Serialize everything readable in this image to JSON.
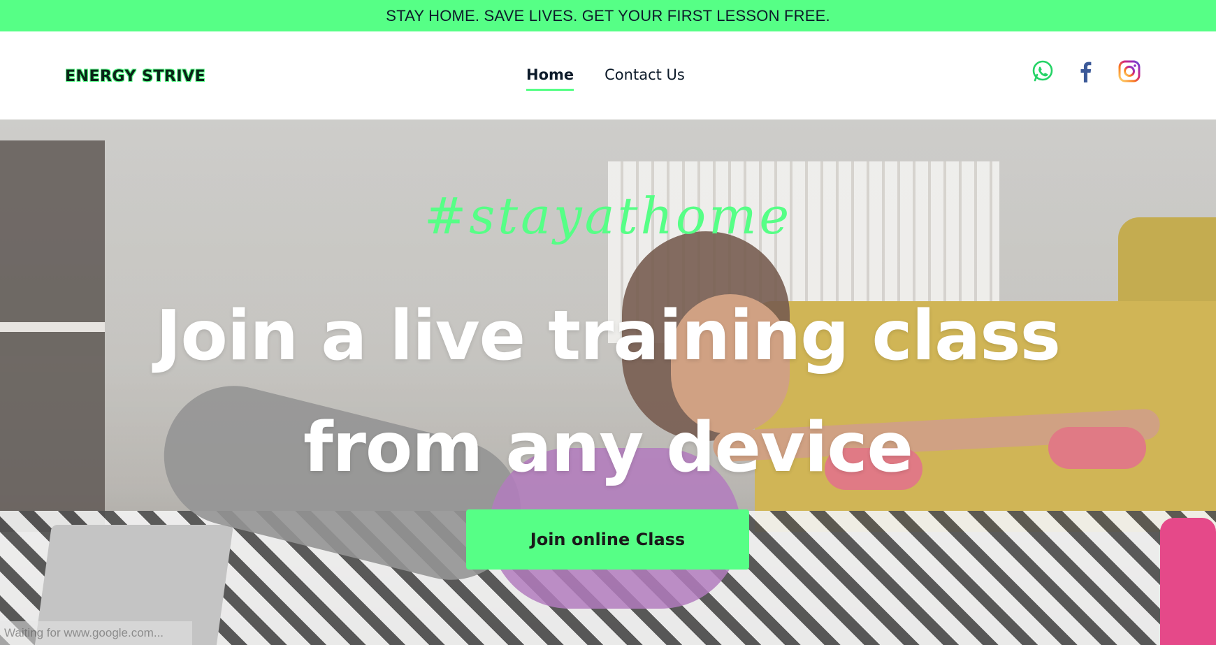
{
  "promo": {
    "text": "STAY HOME. SAVE LIVES. GET YOUR FIRST LESSON FREE."
  },
  "header": {
    "logo": "ENERGY STRIVE",
    "nav": [
      {
        "label": "Home",
        "active": true
      },
      {
        "label": "Contact Us",
        "active": false
      }
    ],
    "socials": [
      {
        "icon": "whatsapp-icon",
        "color": "#25d366"
      },
      {
        "icon": "facebook-icon",
        "color": "#3b5998"
      },
      {
        "icon": "instagram-icon",
        "color": "#c13584"
      }
    ]
  },
  "hero": {
    "hashtag": "#stayathome",
    "headline_line1": "Join a live training class",
    "headline_line2": "from any device",
    "cta_label": "Join online Class"
  },
  "status_bar": {
    "text": "Waiting for www.google.com..."
  },
  "colors": {
    "accent": "#56ff86",
    "text_dark": "#0d1b2a"
  }
}
